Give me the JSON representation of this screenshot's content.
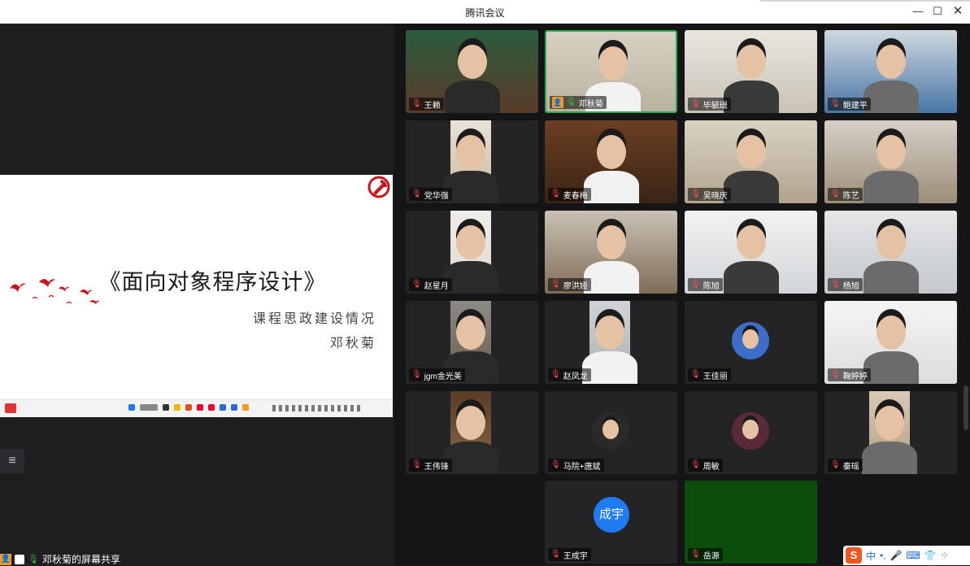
{
  "window": {
    "title": "腾讯会议"
  },
  "controls": {
    "minimize": "—",
    "maximize": "☐",
    "close": "✕"
  },
  "share": {
    "status_label": "邓秋菊的屏幕共享",
    "list_icon": "≡",
    "slide": {
      "title": "《面向对象程序设计》",
      "subtitle": "课程思政建设情况",
      "presenter": "邓秋菊"
    }
  },
  "participants": [
    {
      "name": "王赖",
      "mic": "muted",
      "host": false,
      "active": false,
      "video": "camera"
    },
    {
      "name": "邓秋菊",
      "mic": "on",
      "host": true,
      "active": true,
      "video": "camera"
    },
    {
      "name": "毕毓璟",
      "mic": "muted",
      "host": false,
      "active": false,
      "video": "camera"
    },
    {
      "name": "鲍建平",
      "mic": "muted",
      "host": false,
      "active": false,
      "video": "camera"
    },
    {
      "name": "党华强",
      "mic": "muted",
      "host": false,
      "active": false,
      "video": "narrow"
    },
    {
      "name": "麦春梅",
      "mic": "muted",
      "host": false,
      "active": false,
      "video": "camera"
    },
    {
      "name": "吴晓庆",
      "mic": "muted",
      "host": false,
      "active": false,
      "video": "camera"
    },
    {
      "name": "陈艺",
      "mic": "muted",
      "host": false,
      "active": false,
      "video": "camera"
    },
    {
      "name": "赵星月",
      "mic": "muted",
      "host": false,
      "active": false,
      "video": "narrow"
    },
    {
      "name": "廖洪娅",
      "mic": "muted",
      "host": false,
      "active": false,
      "video": "camera"
    },
    {
      "name": "陈旭",
      "mic": "muted",
      "host": false,
      "active": false,
      "video": "camera"
    },
    {
      "name": "杨旭",
      "mic": "muted",
      "host": false,
      "active": false,
      "video": "camera"
    },
    {
      "name": "jgm金光美",
      "mic": "muted",
      "host": false,
      "active": false,
      "video": "narrow"
    },
    {
      "name": "赵凤龙",
      "mic": "muted",
      "host": false,
      "active": false,
      "video": "narrow"
    },
    {
      "name": "王佳丽",
      "mic": "muted",
      "host": false,
      "active": false,
      "video": "avatar"
    },
    {
      "name": "鞠婷婷",
      "mic": "muted",
      "host": false,
      "active": false,
      "video": "camera"
    },
    {
      "name": "王伟锋",
      "mic": "muted",
      "host": false,
      "active": false,
      "video": "narrow"
    },
    {
      "name": "马院+唐斌",
      "mic": "muted",
      "host": false,
      "active": false,
      "video": "avatar"
    },
    {
      "name": "周敏",
      "mic": "muted",
      "host": false,
      "active": false,
      "video": "avatar"
    },
    {
      "name": "秦瑶",
      "mic": "muted",
      "host": false,
      "active": false,
      "video": "narrow"
    },
    {
      "name": "王成宇",
      "mic": "muted",
      "host": false,
      "active": false,
      "video": "text-avatar",
      "avatar_text": "成宇"
    },
    {
      "name": "岳源",
      "mic": "muted",
      "host": false,
      "active": false,
      "video": "blank-green"
    }
  ],
  "ime": {
    "logo": "S",
    "lang": "中",
    "punct": "•,",
    "items": [
      "🎤",
      "⌨",
      "👕",
      "⁘"
    ]
  },
  "colors": {
    "accent_green": "#2fa84f",
    "mic_muted": "#ff4d4f",
    "mic_on": "#2fbf3a",
    "host_orange": "#f59a23",
    "avatar_blue": "#1f7bf2"
  }
}
